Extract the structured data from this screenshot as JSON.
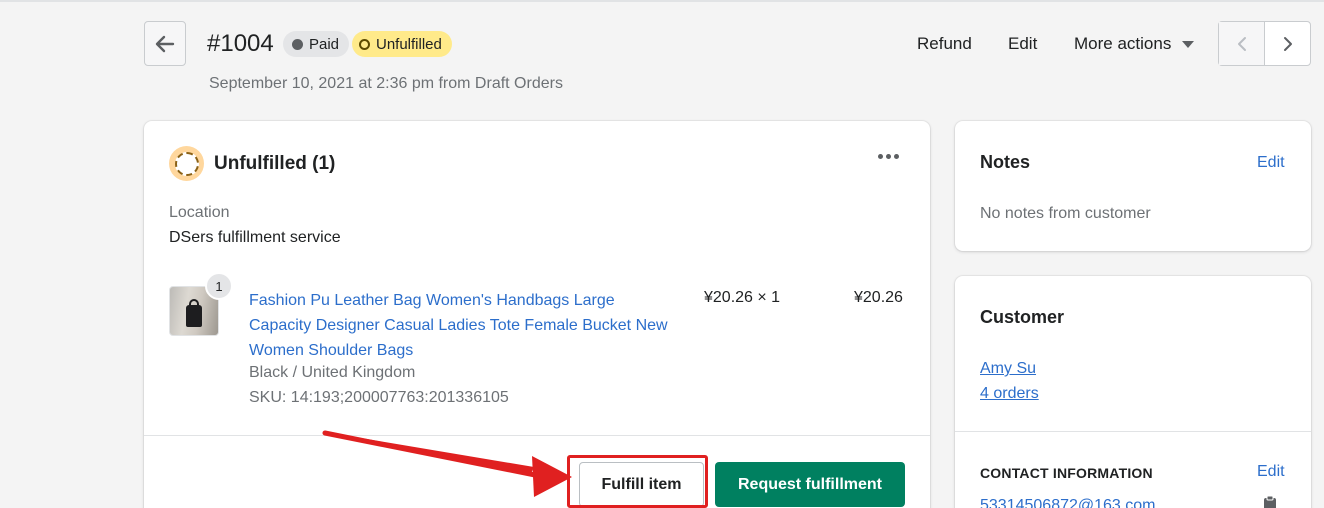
{
  "header": {
    "order_number": "#1004",
    "badges": {
      "paid": "Paid",
      "unfulfilled": "Unfulfilled"
    },
    "subtitle": "September 10, 2021 at 2:36 pm from Draft Orders",
    "actions": {
      "refund": "Refund",
      "edit": "Edit",
      "more": "More actions"
    }
  },
  "fulfillment": {
    "title": "Unfulfilled (1)",
    "location_label": "Location",
    "location_value": "DSers fulfillment service",
    "item": {
      "quantity_badge": "1",
      "title": "Fashion Pu Leather Bag Women's Handbags Large Capacity Designer Casual Ladies Tote Female Bucket New Women Shoulder Bags",
      "variant": "Black / United Kingdom",
      "sku": "SKU: 14:193;200007763:201336105",
      "price_qty": "¥20.26 × 1",
      "total": "¥20.26"
    },
    "buttons": {
      "fulfill": "Fulfill item",
      "request": "Request fulfillment"
    }
  },
  "notes": {
    "title": "Notes",
    "edit": "Edit",
    "empty": "No notes from customer"
  },
  "customer": {
    "title": "Customer",
    "name": "Amy Su",
    "orders": "4 orders",
    "contact_title": "CONTACT INFORMATION",
    "contact_edit": "Edit",
    "email": "53314506872@163.com"
  },
  "colors": {
    "primary_green": "#008060",
    "link_blue": "#2c6ecb",
    "unfulfilled_yellow": "#ffea8a",
    "annotation_red": "#e02020"
  }
}
